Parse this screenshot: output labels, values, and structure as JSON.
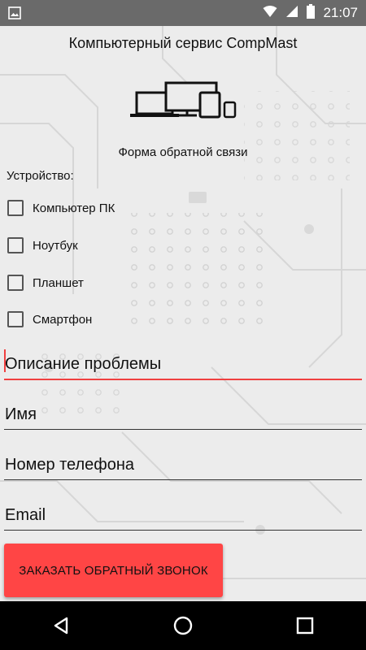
{
  "status_bar": {
    "time": "21:07",
    "icons": [
      "image-notification-icon",
      "wifi-icon",
      "signal-icon",
      "battery-icon"
    ]
  },
  "app": {
    "title": "Компьютерный сервис CompMast",
    "logo_icon": "devices-icon",
    "form_title": "Форма обратной связи",
    "device_label": "Устройство:",
    "devices": [
      {
        "label": "Компьютер ПК",
        "checked": false
      },
      {
        "label": "Ноутбук",
        "checked": false
      },
      {
        "label": "Планшет",
        "checked": false
      },
      {
        "label": "Смартфон",
        "checked": false
      }
    ],
    "fields": {
      "description": {
        "placeholder": "Описание проблемы",
        "focused": true
      },
      "name": {
        "placeholder": "Имя"
      },
      "phone": {
        "placeholder": "Номер телефона"
      },
      "email": {
        "placeholder": "Email"
      }
    },
    "submit_label": "ЗАКАЗАТЬ ОБРАТНЫЙ ЗВОНОК",
    "colors": {
      "accent": "#ff4545",
      "focus_underline": "#f04040",
      "status_bar": "#6a6a6a",
      "nav_bar": "#000000"
    }
  },
  "nav_bar": {
    "icons": [
      "back-icon",
      "home-icon",
      "recents-icon"
    ]
  }
}
